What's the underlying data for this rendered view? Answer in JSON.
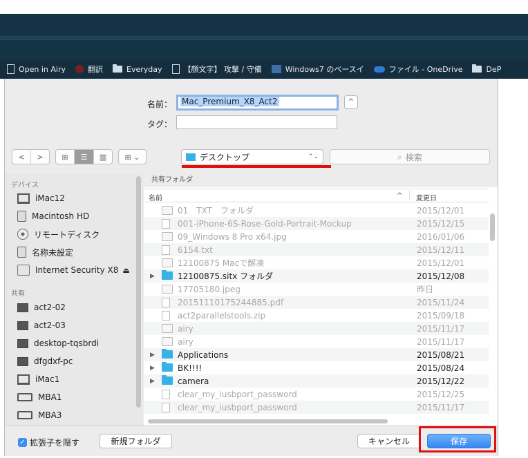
{
  "bookmarks": [
    {
      "icon": "page-icon",
      "label": "Open in Airy"
    },
    {
      "icon": "bug-icon",
      "label": "翻訳"
    },
    {
      "icon": "folder-icon",
      "label": "Everyday"
    },
    {
      "icon": "page-icon",
      "label": "【顔文字】 攻撃 / 守備"
    },
    {
      "icon": "windows-icon",
      "label": "Windows7 のベースイ"
    },
    {
      "icon": "cloud-icon",
      "label": "ファイル - OneDrive"
    },
    {
      "icon": "folder-icon",
      "label": "DeP"
    }
  ],
  "form": {
    "name_label": "名前：",
    "name_value": "Mac_Premium_X8_Act2",
    "tag_label": "タグ：",
    "tag_value": "",
    "expand_glyph": "^"
  },
  "toolbar": {
    "back": "<",
    "forward": ">",
    "view_icon": "⊞",
    "view_list": "☰",
    "view_columns": "▥",
    "arrange": "⊞ ⌄",
    "location": "デスクトップ",
    "location_arrows": "⌃⌄",
    "search_placeholder": "検索"
  },
  "sidebar": {
    "devices_header": "デバイス",
    "devices": [
      {
        "icon": "imac-icon",
        "label": "iMac12"
      },
      {
        "icon": "disk-icon",
        "label": "Macintosh HD"
      },
      {
        "icon": "cd-icon",
        "label": "リモートディスク"
      },
      {
        "icon": "disk-icon",
        "label": "名称未設定"
      },
      {
        "icon": "hd-icon",
        "label": "Internet Security X8",
        "eject": "⏏"
      }
    ],
    "shared_header": "共有",
    "shared": [
      {
        "icon": "pc-icon",
        "label": "act2-02"
      },
      {
        "icon": "pc-icon",
        "label": "act2-03"
      },
      {
        "icon": "pc-icon",
        "label": "desktop-tqsbrdi"
      },
      {
        "icon": "pc-icon",
        "label": "dfgdxf-pc"
      },
      {
        "icon": "imac-icon",
        "label": "iMac1"
      },
      {
        "icon": "laptop-icon",
        "label": "MBA1"
      },
      {
        "icon": "laptop-icon",
        "label": "MBA3"
      }
    ]
  },
  "filelist": {
    "section_title": "共有フォルダ",
    "col_name": "名前",
    "col_date": "変更日",
    "sort_glyph": "^",
    "rows": [
      {
        "name": "01　TXT　フォルダ",
        "date": "2015/12/01",
        "type": "file",
        "dim": true
      },
      {
        "name": "001-iPhone-6S-Rose-Gold-Portrait-Mockup",
        "date": "2015/12/15",
        "type": "doc",
        "dim": true
      },
      {
        "name": "09_Windows 8 Pro x64.jpg",
        "date": "2016/01/06",
        "type": "file",
        "dim": true
      },
      {
        "name": "6154.txt",
        "date": "2015/12/11",
        "type": "doc",
        "dim": true
      },
      {
        "name": "12100875 Macで解凍",
        "date": "2015/12/01",
        "type": "file",
        "dim": true
      },
      {
        "name": "12100875.sitx フォルダ",
        "date": "2015/12/08",
        "type": "folder",
        "dim": false
      },
      {
        "name": "17705180.jpeg",
        "date": "昨日",
        "type": "file",
        "dim": true
      },
      {
        "name": "20151110175244885.pdf",
        "date": "2015/11/24",
        "type": "doc",
        "dim": true
      },
      {
        "name": "act2parallelstools.zip",
        "date": "2015/09/18",
        "type": "doc",
        "dim": true
      },
      {
        "name": "airy",
        "date": "2015/11/17",
        "type": "file",
        "dim": true
      },
      {
        "name": "airy",
        "date": "2015/11/17",
        "type": "file",
        "dim": true
      },
      {
        "name": "Applications",
        "date": "2015/08/21",
        "type": "folder",
        "dim": false
      },
      {
        "name": "BK!!!!",
        "date": "2015/08/24",
        "type": "folder",
        "dim": false
      },
      {
        "name": "camera",
        "date": "2015/12/22",
        "type": "folder",
        "dim": false
      },
      {
        "name": "clear_my_iusbport_password",
        "date": "2015/12/25",
        "type": "doc",
        "dim": true
      },
      {
        "name": "clear_my_iusbport_password",
        "date": "2015/11/17",
        "type": "doc",
        "dim": true
      }
    ]
  },
  "footer": {
    "hide_ext_label": "拡張子を隠す",
    "new_folder": "新規フォルダ",
    "cancel": "キャンセル",
    "save": "保存"
  },
  "colors": {
    "accent": "#3787f3",
    "highlight": "#e20f0f",
    "folder": "#38b1e7"
  }
}
